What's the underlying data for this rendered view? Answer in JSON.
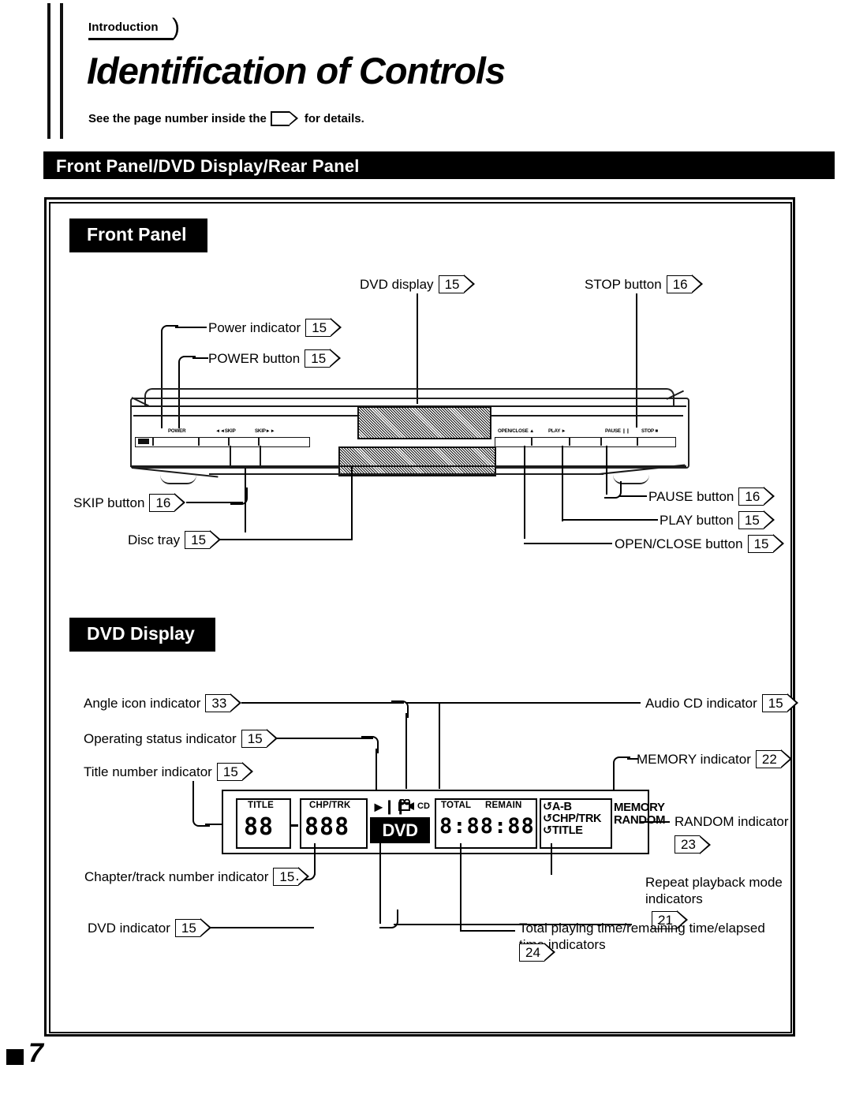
{
  "header": {
    "breadcrumb": "Introduction",
    "title": "Identification of Controls",
    "note_before": "See the page number inside the",
    "note_after": "for details."
  },
  "section_bar": {
    "label": "Front Panel/DVD Display/Rear Panel"
  },
  "sections": [
    {
      "id": "front-panel",
      "heading": "Front Panel"
    },
    {
      "id": "dvd-display",
      "heading": "DVD Display"
    }
  ],
  "front_panel": {
    "device_labels": {
      "power": "POWER",
      "skip_back": "◄◄SKIP",
      "skip_fwd": "SKIP►►",
      "open_close": "OPEN/CLOSE ▲",
      "play": "PLAY ►",
      "pause": "PAUSE ❙❙",
      "stop": "STOP ■"
    },
    "callouts": [
      {
        "name": "dvd-display",
        "label": "DVD display",
        "page": "15"
      },
      {
        "name": "stop-button",
        "label": "STOP button",
        "page": "16"
      },
      {
        "name": "power-indicator",
        "label": "Power indicator",
        "page": "15"
      },
      {
        "name": "power-button",
        "label": "POWER button",
        "page": "15"
      },
      {
        "name": "skip-button",
        "label": "SKIP button",
        "page": "16"
      },
      {
        "name": "disc-tray",
        "label": "Disc tray",
        "page": "15"
      },
      {
        "name": "pause-button",
        "label": "PAUSE button",
        "page": "16"
      },
      {
        "name": "play-button",
        "label": "PLAY button",
        "page": "15"
      },
      {
        "name": "open-close-button",
        "label": "OPEN/CLOSE button",
        "page": "15"
      }
    ]
  },
  "dvd_display": {
    "callouts": [
      {
        "name": "angle-icon-indicator",
        "label": "Angle icon indicator",
        "page": "33"
      },
      {
        "name": "operating-status-indicator",
        "label": "Operating status indicator",
        "page": "15"
      },
      {
        "name": "title-number-indicator",
        "label": "Title number indicator",
        "page": "15"
      },
      {
        "name": "audio-cd-indicator",
        "label": "Audio CD indicator",
        "page": "15"
      },
      {
        "name": "memory-indicator",
        "label": "MEMORY indicator",
        "page": "22"
      },
      {
        "name": "random-indicator",
        "label": "RANDOM indicator",
        "page": "23"
      },
      {
        "name": "chapter-track-number-indicator",
        "label": "Chapter/track number indicator",
        "page": "15"
      },
      {
        "name": "repeat-playback-mode-indicators",
        "label": "Repeat playback mode indicators",
        "page": "21"
      },
      {
        "name": "dvd-indicator",
        "label": "DVD indicator",
        "page": "15"
      },
      {
        "name": "total-time-indicators",
        "label": "Total playing time/remaining time/elapsed time indicators",
        "page": "24"
      }
    ],
    "panel": {
      "title_caption": "TITLE",
      "title_digits": "88",
      "separator": "-",
      "chptrk_caption": "CHP/TRK",
      "chptrk_digits": "888",
      "status_play": "►",
      "status_pause": "❙❙",
      "angle_icon": "angle-camera-icon",
      "cd_label": "CD",
      "dvd_label": "DVD",
      "total_caption": "TOTAL",
      "remain_caption": "REMAIN",
      "time_digits": "8:88:88",
      "repeat_ab": "A-B",
      "repeat_chptrk": "CHP/TRK",
      "repeat_title": "TITLE",
      "repeat_symbol": "↺",
      "memory_label": "MEMORY",
      "random_label": "RANDOM"
    }
  },
  "footer": {
    "page_number": "7"
  }
}
